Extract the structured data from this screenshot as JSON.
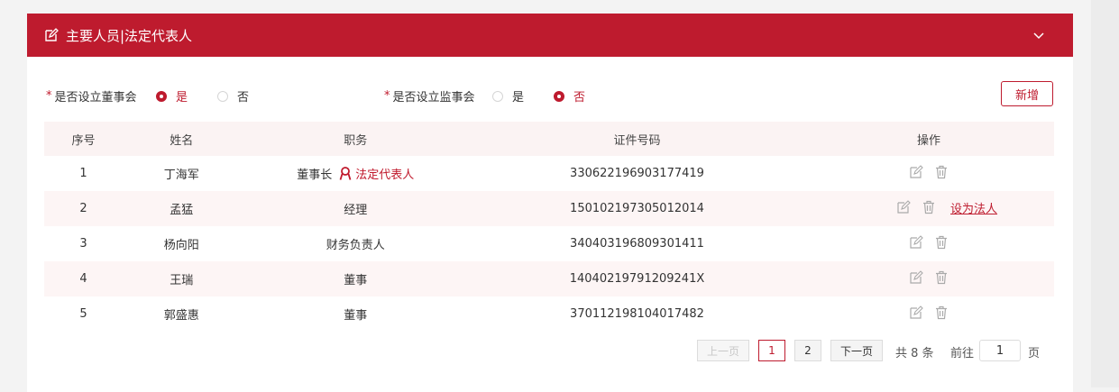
{
  "section": {
    "title": "主要人员|法定代表人"
  },
  "form": {
    "board": {
      "question": "是否设立董事会",
      "required_mark": "*",
      "yes": "是",
      "no": "否",
      "selected": "是"
    },
    "supervisory": {
      "question": "是否设立监事会",
      "required_mark": "*",
      "yes": "是",
      "no": "否",
      "selected": "否"
    },
    "add_label": "新增"
  },
  "table": {
    "headers": {
      "index": "序号",
      "name": "姓名",
      "duty": "职务",
      "id_no": "证件号码",
      "ops": "操作"
    },
    "rows": [
      {
        "index": "1",
        "name": "丁海军",
        "duty": "董事长",
        "badge": "法定代表人",
        "id_no": "330622196903177419",
        "action": ""
      },
      {
        "index": "2",
        "name": "孟猛",
        "duty": "经理",
        "badge": "",
        "id_no": "150102197305012014",
        "action": "设为法人"
      },
      {
        "index": "3",
        "name": "杨向阳",
        "duty": "财务负责人",
        "badge": "",
        "id_no": "340403196809301411",
        "action": ""
      },
      {
        "index": "4",
        "name": "王瑞",
        "duty": "董事",
        "badge": "",
        "id_no": "14040219791209241X",
        "action": ""
      },
      {
        "index": "5",
        "name": "郭盛惠",
        "duty": "董事",
        "badge": "",
        "id_no": "370112198104017482",
        "action": ""
      }
    ]
  },
  "pagination": {
    "prev": "上一页",
    "next": "下一页",
    "pages": [
      "1",
      "2"
    ],
    "current": "1",
    "total": "共 8 条",
    "goto": "前往",
    "goto_value": "1",
    "page_unit": "页"
  },
  "colors": {
    "brand": "#be1b2e",
    "row_alt": "#fdf5f5"
  },
  "icons": {
    "header": "edit-icon",
    "collapse": "chevron-down-icon",
    "legal": "person-badge-icon",
    "edit": "edit-icon",
    "delete": "trash-icon"
  }
}
